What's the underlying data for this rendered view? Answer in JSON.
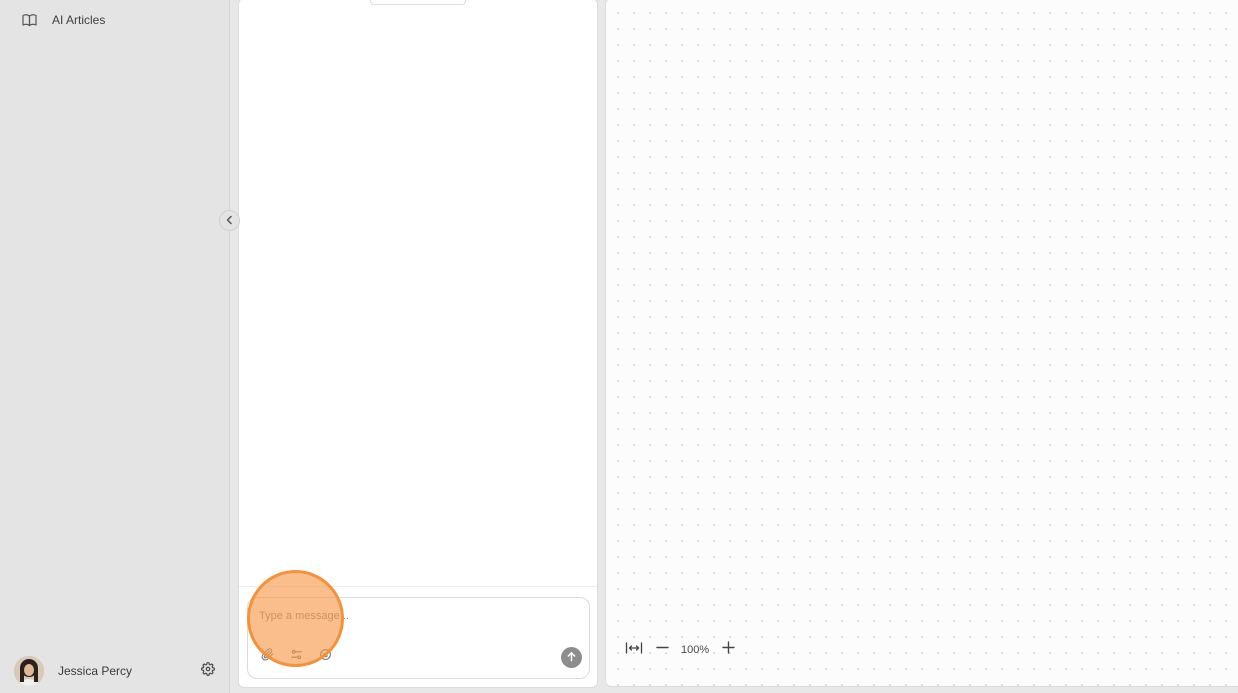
{
  "sidebar": {
    "items": [
      {
        "label": "AI Articles",
        "icon": "book-open-icon"
      }
    ],
    "user": {
      "name": "Jessica Percy"
    }
  },
  "chat": {
    "composer": {
      "placeholder": "Type a message..."
    }
  },
  "canvas": {
    "zoom": {
      "level": "100%"
    }
  },
  "colors": {
    "highlight": "#f4923b",
    "send_button": "#8d8d8d"
  }
}
